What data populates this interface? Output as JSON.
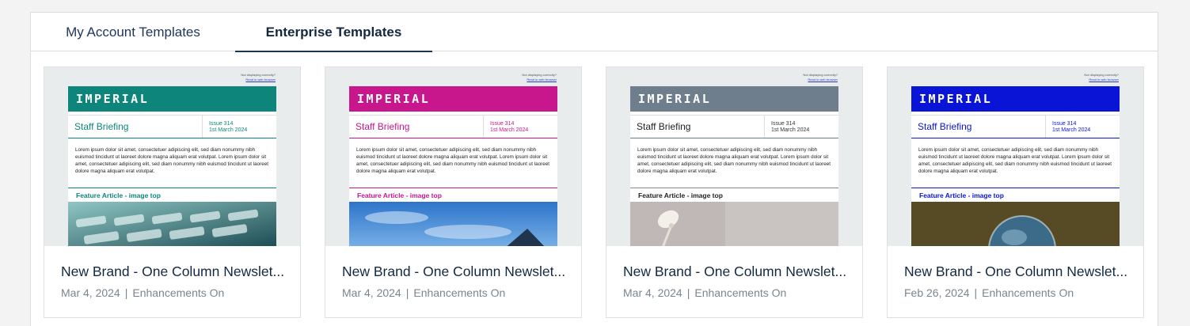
{
  "tabs": [
    {
      "label": "My Account Templates",
      "active": false
    },
    {
      "label": "Enterprise Templates",
      "active": true
    }
  ],
  "cards": [
    {
      "title": "New Brand - One Column Newslet...",
      "date": "Mar 4, 2024",
      "status": "Enhancements On",
      "preview": {
        "not_displaying": "Not displaying correctly?",
        "web_link": "Read in web browser",
        "brand": "IMPERIAL",
        "heading": "Staff Briefing",
        "issue": "Issue 314",
        "issue_date": "1st March 2024",
        "body": "Lorem ipsum dolor sit amet, consectetuer adipiscing elit, sed diam nonummy nibh euismod tincidunt ut laoreet dolore magna aliquam erat volutpat. Lorem ipsum dolor sit amet, consectetuer adipiscing elit, sed diam nonummy nibh euismod tincidunt ut laoreet dolore magna aliquam erat volutpat.",
        "feature": "Feature Article - image top",
        "accent": "#0e857a",
        "image": "keyboard-photo"
      }
    },
    {
      "title": "New Brand - One Column Newslet...",
      "date": "Mar 4, 2024",
      "status": "Enhancements On",
      "preview": {
        "not_displaying": "Not displaying correctly?",
        "web_link": "Read in web browser",
        "brand": "IMPERIAL",
        "heading": "Staff Briefing",
        "issue": "Issue 314",
        "issue_date": "1st March 2024",
        "body": "Lorem ipsum dolor sit amet, consectetuer adipiscing elit, sed diam nonummy nibh euismod tincidunt ut laoreet dolore magna aliquam erat volutpat. Lorem ipsum dolor sit amet, consectetuer adipiscing elit, sed diam nonummy nibh euismod tincidunt ut laoreet dolore magna aliquam erat volutpat.",
        "feature": "Feature Article - image top",
        "accent": "#c8178c",
        "image": "sky-photo"
      }
    },
    {
      "title": "New Brand - One Column Newslet...",
      "date": "Mar 4, 2024",
      "status": "Enhancements On",
      "preview": {
        "not_displaying": "Not displaying correctly?",
        "web_link": "Read in web browser",
        "brand": "IMPERIAL",
        "heading": "Staff Briefing",
        "issue": "Issue 314",
        "issue_date": "1st March 2024",
        "body": "Lorem ipsum dolor sit amet, consectetuer adipiscing elit, sed diam nonummy nibh euismod tincidunt ut laoreet dolore magna aliquam erat volutpat. Lorem ipsum dolor sit amet, consectetuer adipiscing elit, sed diam nonummy nibh euismod tincidunt ut laoreet dolore magna aliquam erat volutpat.",
        "feature": "Feature Article - image top",
        "accent": "#6f7e8c",
        "image": "lamp-photo"
      }
    },
    {
      "title": "New Brand - One Column Newslet...",
      "date": "Feb 26, 2024",
      "status": "Enhancements On",
      "preview": {
        "not_displaying": "Not displaying correctly?",
        "web_link": "Read in web browser",
        "brand": "IMPERIAL",
        "heading": "Staff Briefing",
        "issue": "Issue 314",
        "issue_date": "1st March 2024",
        "body": "Lorem ipsum dolor sit amet, consectetuer adipiscing elit, sed diam nonummy nibh euismod tincidunt ut laoreet dolore magna aliquam erat volutpat. Lorem ipsum dolor sit amet, consectetuer adipiscing elit, sed diam nonummy nibh euismod tincidunt ut laoreet dolore magna aliquam erat volutpat.",
        "feature": "Feature Article - image top",
        "accent": "#0a14d6",
        "image": "globe-photo"
      }
    }
  ]
}
